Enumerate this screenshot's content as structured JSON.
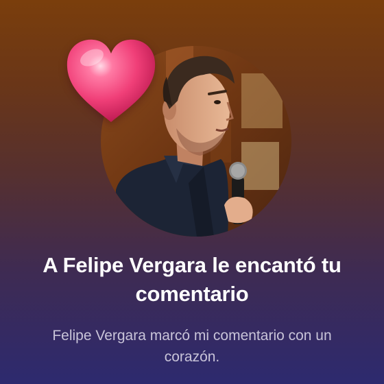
{
  "notification": {
    "title": "A Felipe Vergara le encantó tu comentario",
    "subtitle": "Felipe Vergara marcó mi comentario con un corazón.",
    "reaction_icon": "heart-icon",
    "colors": {
      "heart": "#e8336e",
      "text_primary": "#ffffff",
      "text_secondary": "#c9c4d9"
    }
  }
}
